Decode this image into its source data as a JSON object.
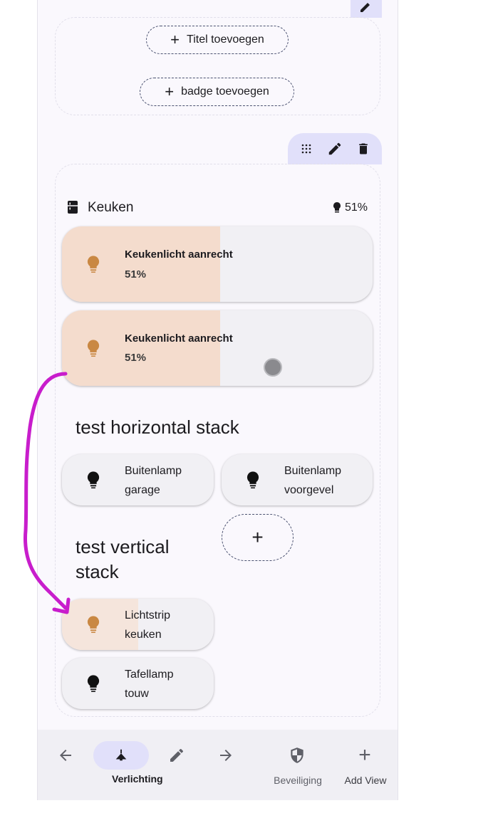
{
  "section_top": {
    "add_title_label": "Titel toevoegen",
    "add_badge_label": "badge toevoegen"
  },
  "area": {
    "name": "Keuken",
    "light_summary": "51%"
  },
  "tiles": [
    {
      "name": "Keukenlicht aanrecht",
      "state": "51%",
      "brightness": 0.51
    },
    {
      "name": "Keukenlicht aanrecht",
      "state": "51%",
      "brightness": 0.51
    }
  ],
  "horizontal_stack": {
    "heading": "test horizontal stack",
    "items": [
      {
        "line1": "Buitenlamp",
        "line2": "garage"
      },
      {
        "line1": "Buitenlamp",
        "line2": "voorgevel"
      }
    ]
  },
  "vertical_stack": {
    "heading_line1": "test vertical",
    "heading_line2": "stack",
    "items": [
      {
        "line1": "Lichtstrip",
        "line2": "keuken",
        "brightness": 0.5
      },
      {
        "line1": "Tafellamp",
        "line2": "touw"
      }
    ]
  },
  "navbar": {
    "active_view": "Verlichting",
    "security_view": "Beveiliging",
    "add_view": "Add View"
  },
  "colors": {
    "accent_bg": "#e1e0fa",
    "light_on": "#c98843",
    "tile_fill": "#f4dccd",
    "annotation": "#c81dcc"
  }
}
